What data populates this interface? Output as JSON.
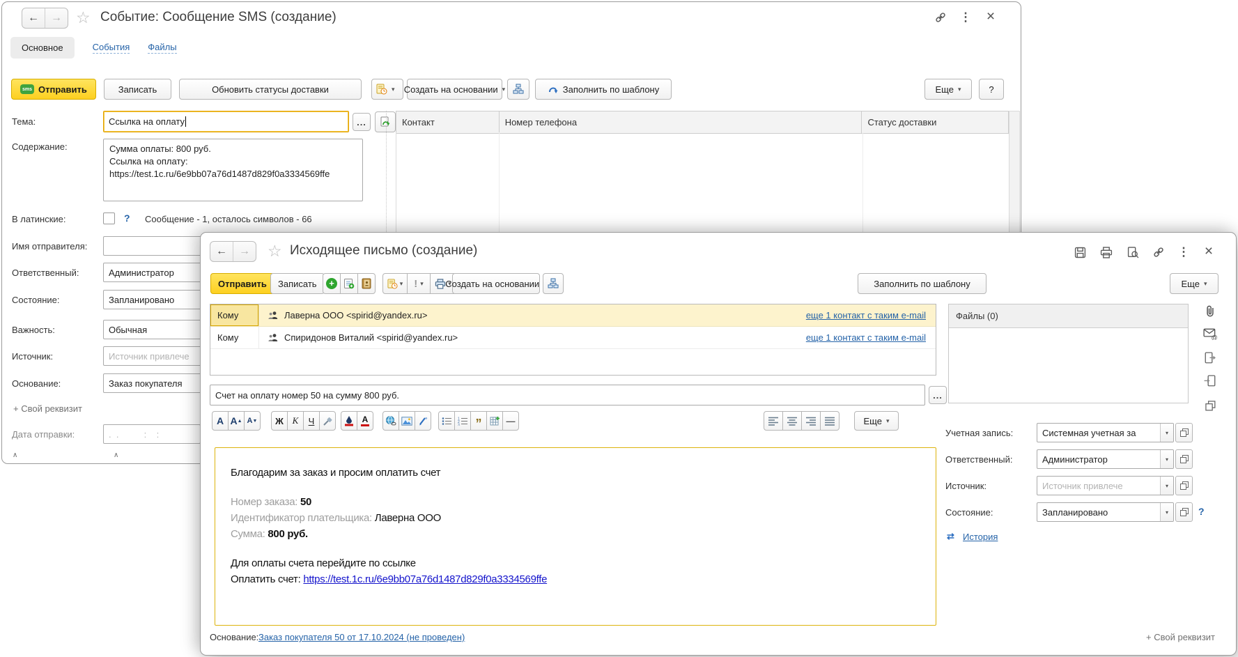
{
  "icons": {
    "back": "←",
    "forward": "→",
    "star": "☆",
    "menu_dots": "⋮",
    "close": "×",
    "dropdown": "▾",
    "ellipsis": "...",
    "help": "?",
    "history": "⇄",
    "bold": "Ж",
    "italic": "К",
    "underline": "Ч",
    "font_letter": "А",
    "up_mark": "▲",
    "down_mark": "▼",
    "quote": "”",
    "hrule": "—",
    "importance": "!",
    "caret_top": "∧",
    "sms_badge": "sms",
    "plus": "+",
    "at": "@"
  },
  "colors": {
    "accent_yellow": "#fdd020",
    "focus_border": "#e2a203",
    "link_blue": "#2563a8",
    "selected_row": "#fdf3cd",
    "selected_cell": "#f8e6a0",
    "table_header": "#f3f3f3"
  },
  "sms_window": {
    "title": "Событие: Сообщение SMS (создание)",
    "tabs": [
      {
        "label": "Основное"
      },
      {
        "label": "События"
      },
      {
        "label": "Файлы"
      }
    ],
    "toolbar": {
      "send": "Отправить",
      "save": "Записать",
      "update_statuses": "Обновить статусы доставки",
      "create_based_on": "Создать на основании",
      "fill_by_template": "Заполнить по шаблону",
      "more": "Еще",
      "help": "?"
    },
    "fields": {
      "theme_label": "Тема:",
      "theme_value": "Ссылка на оплату",
      "content_label": "Содержание:",
      "content_line1": "Сумма оплаты: 800 руб.",
      "content_line2": "Ссылка на оплату:",
      "content_line3": "https://test.1c.ru/6e9bb07a76d1487d829f0a3334569ffe",
      "to_latin_label": "В латинские:",
      "counter_text": "Сообщение - 1, осталось символов - 66",
      "sender_name_label": "Имя отправителя:",
      "responsible_label": "Ответственный:",
      "responsible_value": "Администратор",
      "state_label": "Состояние:",
      "state_value": "Запланировано",
      "importance_label": "Важность:",
      "importance_value": "Обычная",
      "source_label": "Источник:",
      "source_placeholder": "Источник привлече",
      "basis_label": "Основание:",
      "basis_value": "Заказ покупателя",
      "custom_attribute": "+ Свой реквизит",
      "send_date_label": "Дата отправки:",
      "send_date_placeholder": ".  .          :    :"
    },
    "table": {
      "columns": [
        "Контакт",
        "Номер телефона",
        "Статус доставки"
      ]
    }
  },
  "email_window": {
    "title": "Исходящее письмо (создание)",
    "toolbar": {
      "send": "Отправить",
      "save": "Записать",
      "create_based_on": "Создать на основании",
      "fill_by_template": "Заполнить по шаблону",
      "more": "Еще"
    },
    "recipients": [
      {
        "type": "Кому",
        "value": "Лаверна ООО <spirid@yandex.ru>",
        "link": "еще 1 контакт с таким e-mail"
      },
      {
        "type": "Кому",
        "value": "Спиридонов Виталий  <spirid@yandex.ru>",
        "link": "еще 1 контакт с таким e-mail"
      }
    ],
    "subject_value": "Счет на оплату номер 50 на сумму 800 руб.",
    "format_toolbar": {
      "more": "Еще"
    },
    "body": {
      "greeting": "Благодарим за заказ и просим оплатить счет",
      "order_label": "Номер заказа:",
      "order_value": "50",
      "payer_label": "Идентификатор плательщика:",
      "payer_value": "Лаверна ООО",
      "sum_label": "Сумма:",
      "sum_value": "800 руб.",
      "pay_intro": "Для оплаты счета перейдите по ссылке",
      "pay_label": "Оплатить счет:",
      "pay_link": "https://test.1c.ru/6e9bb07a76d1487d829f0a3334569ffe"
    },
    "right_panel": {
      "files_header": "Файлы (0)",
      "account_label": "Учетная запись:",
      "account_value": "Системная учетная за",
      "responsible_label": "Ответственный:",
      "responsible_value": "Администратор",
      "source_label": "Источник:",
      "source_placeholder": "Источник привлече",
      "state_label": "Состояние:",
      "state_value": "Запланировано",
      "history_link": "История"
    },
    "footer": {
      "basis_label": "Основание:",
      "basis_link": "Заказ покупателя 50 от 17.10.2024 (не проведен)",
      "custom_attribute": "+ Свой реквизит"
    }
  }
}
